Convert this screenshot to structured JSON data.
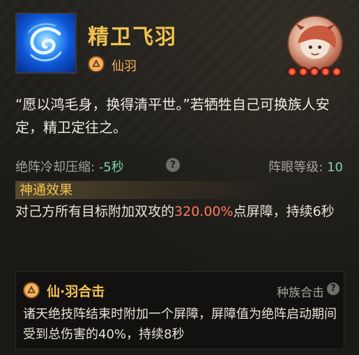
{
  "skill": {
    "title": "精卫飞羽",
    "icon": "water-swirl-icon",
    "faction_icon": "xian-faction-icon",
    "faction_label": "仙羽",
    "avatar": "character-portrait-avatar",
    "star_count": 5
  },
  "quote": "“愿以鸿毛身，换得清平世。”若牺牲自己可换族人安定，精卫定往之。",
  "stats": {
    "cooldown_label": "绝阵冷却压缩:",
    "cooldown_value": "-5秒",
    "help_icon": "?",
    "eye_label": "阵眼等级:",
    "eye_value": "10"
  },
  "effect": {
    "header": "神通效果",
    "text_before": "对己方所有目标附加双攻的",
    "highlight": "320.00%",
    "text_after": "点屏障，持续6秒"
  },
  "combo": {
    "icon": "xian-faction-icon",
    "title": "仙·羽合击",
    "tag": "种族合击",
    "help_icon": "?",
    "description": "诸天绝技阵结束时附加一个屏障，屏障值为绝阵启动期间受到总伤害的40%，持续8秒"
  },
  "colors": {
    "gold": "#f2c24f",
    "faction": "#f0b25f",
    "stat_value": "#7fd2a4",
    "highlight": "#ff7a5f"
  }
}
